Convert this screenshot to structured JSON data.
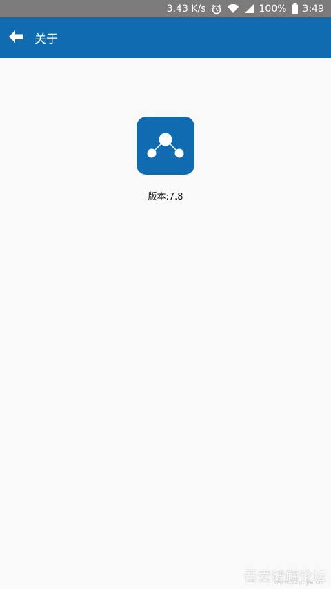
{
  "status_bar": {
    "speed": "3.43 K/s",
    "battery": "100%",
    "time": "3:49"
  },
  "app_bar": {
    "title": "关于"
  },
  "about": {
    "version_label": "版本:7.8"
  },
  "watermark": {
    "text": "吾爱破解论坛",
    "url": "www.52pojie.cn"
  },
  "colors": {
    "primary": "#106bb0",
    "status_bar": "#7b7b7b",
    "background": "#f9f9f9"
  }
}
